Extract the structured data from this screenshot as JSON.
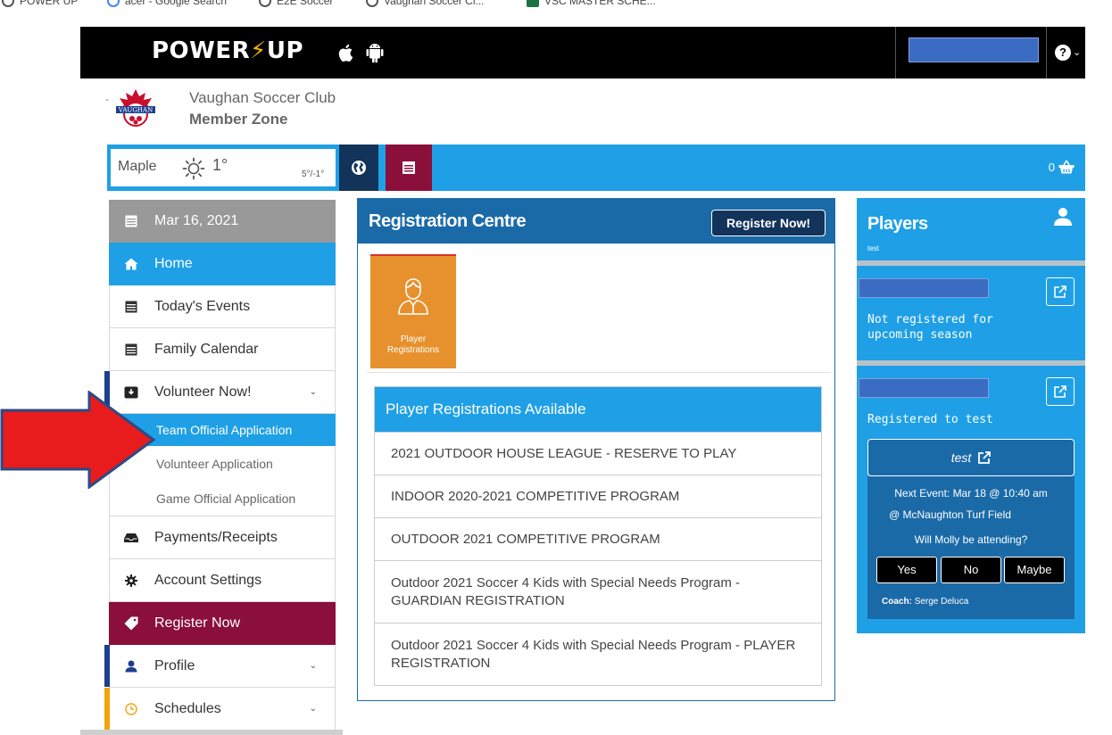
{
  "bookmarks": [
    {
      "label": "POWER UP"
    },
    {
      "label": "acer - Google Search"
    },
    {
      "label": "E2E Soccer"
    },
    {
      "label": "Vaughan Soccer Cl..."
    },
    {
      "label": "VSC MASTER SCHE..."
    }
  ],
  "topbar": {
    "logo_left": "POWER",
    "logo_bolt": "⚡",
    "logo_right": "UP",
    "help_caret": "⌄"
  },
  "club": {
    "dash": "-",
    "name": "Vaughan Soccer Club",
    "zone": "Member Zone"
  },
  "weather": {
    "location": "Maple",
    "temp": "1°",
    "range": "5°/-1°"
  },
  "cart": {
    "count": "0"
  },
  "sidebar": {
    "date": "Mar 16, 2021",
    "items": {
      "home": "Home",
      "todays_events": "Today's Events",
      "family_calendar": "Family Calendar",
      "volunteer_now": "Volunteer Now!",
      "payments": "Payments/Receipts",
      "account_settings": "Account Settings",
      "register_now": "Register Now",
      "profile": "Profile",
      "schedules": "Schedules"
    },
    "volunteer_sub": {
      "team_official": "Team Official Application",
      "volunteer": "Volunteer Application",
      "game_official": "Game Official Application"
    },
    "caret": "⌄"
  },
  "registration": {
    "title": "Registration Centre",
    "register_now_btn": "Register Now!",
    "tile_label_1": "Player",
    "tile_label_2": "Registrations",
    "available_header": "Player Registrations Available",
    "programs": [
      "2021 OUTDOOR HOUSE LEAGUE - RESERVE TO PLAY",
      "INDOOR 2020-2021 COMPETITIVE PROGRAM",
      "OUTDOOR 2021 COMPETITIVE PROGRAM",
      "Outdoor 2021 Soccer 4 Kids with Special Needs Program - GUARDIAN REGISTRATION",
      "Outdoor 2021 Soccer 4 Kids with Special Needs Program - PLAYER REGISTRATION"
    ]
  },
  "players": {
    "title": "Players",
    "subtitle": "test",
    "player1_status_1": "Not registered for",
    "player1_status_2": "upcoming season",
    "player2_status": "Registered to test",
    "team_name": "test",
    "next_event": "Next Event: Mar 18 @ 10:40 am",
    "event_location": "@ McNaughton Turf Field",
    "attend_question": "Will Molly be attending?",
    "rsvp_yes": "Yes",
    "rsvp_no": "No",
    "rsvp_maybe": "Maybe",
    "coach_label": "Coach:",
    "coach_name": "Serge Deluca"
  },
  "colors": {
    "brand_blue": "#1fa0e6",
    "dark_blue": "#1a6aa8",
    "navy": "#12335a",
    "maroon": "#8a0f3a",
    "orange": "#e6912d",
    "arrow_red": "#e81c1c"
  }
}
